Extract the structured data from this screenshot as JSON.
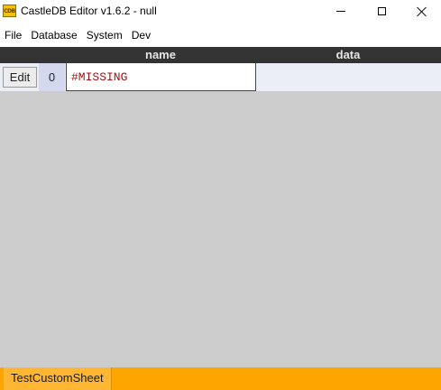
{
  "window": {
    "title": "CastleDB Editor v1.6.2 - null",
    "icon_text": "CDB",
    "icon_name": "castledb-logo-icon",
    "controls": {
      "minimize_icon": "minimize-icon",
      "maximize_icon": "maximize-icon",
      "close_icon": "close-icon"
    }
  },
  "menubar": {
    "items": [
      {
        "label": "File"
      },
      {
        "label": "Database"
      },
      {
        "label": "System"
      },
      {
        "label": "Dev"
      }
    ]
  },
  "table": {
    "columns": [
      {
        "label": "name"
      },
      {
        "label": "data"
      }
    ],
    "rows": [
      {
        "edit_label": "Edit",
        "index": "0",
        "name": "#MISSING",
        "data": ""
      }
    ]
  },
  "sheets": {
    "tabs": [
      {
        "label": "TestCustomSheet",
        "active": true
      }
    ]
  },
  "colors": {
    "header_bg": "#333333",
    "row_bg": "#eceef7",
    "index_bg": "#d3d8ee",
    "missing_text": "#a01010",
    "body_bg": "#cccccc",
    "tabbar_bg": "#ffa500"
  }
}
